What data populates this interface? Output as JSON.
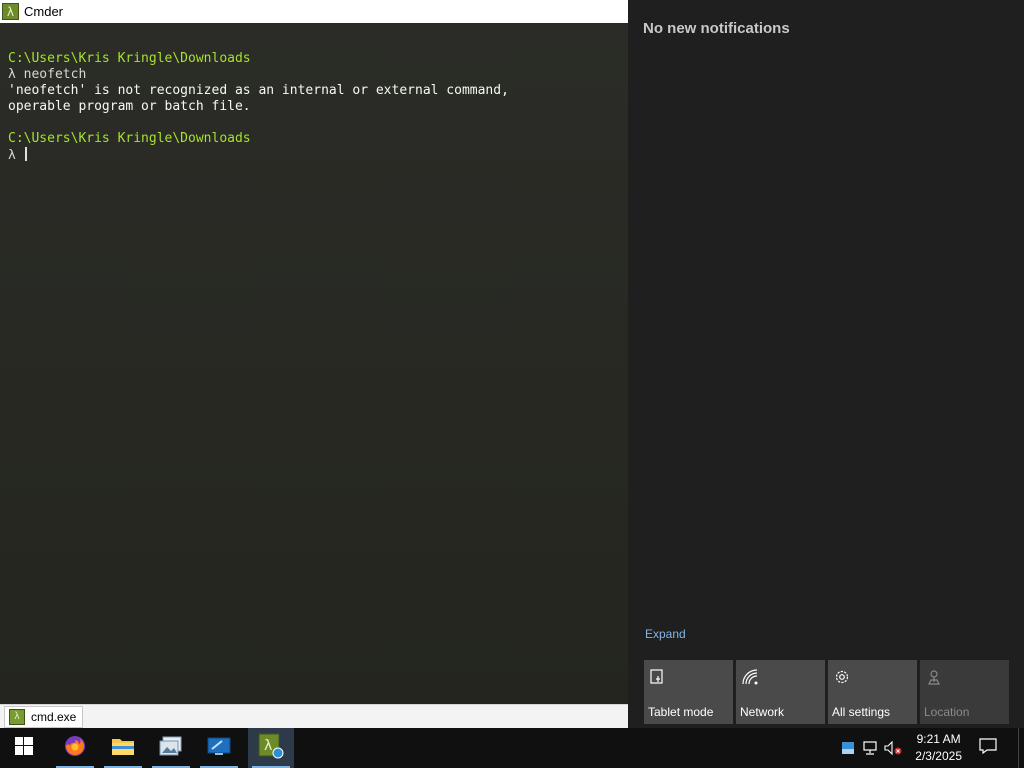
{
  "window": {
    "title": "Cmder",
    "icon": "lambda-icon"
  },
  "terminal": {
    "lines": [
      {
        "type": "path",
        "text": "C:\\Users\\Kris Kringle\\Downloads"
      },
      {
        "type": "prompt",
        "text": "λ neofetch"
      },
      {
        "type": "output",
        "text": "'neofetch' is not recognized as an internal or external command,"
      },
      {
        "type": "output",
        "text": "operable program or batch file."
      },
      {
        "type": "blank",
        "text": ""
      },
      {
        "type": "path",
        "text": "C:\\Users\\Kris Kringle\\Downloads"
      },
      {
        "type": "prompt",
        "text": "λ "
      }
    ]
  },
  "statusbar": {
    "tab_label": "cmd.exe"
  },
  "action_center": {
    "header": "No new notifications",
    "expand_label": "Expand",
    "quick_actions": [
      {
        "label": "Tablet mode",
        "icon": "tablet-mode-icon",
        "enabled": true
      },
      {
        "label": "Network",
        "icon": "network-icon",
        "enabled": true
      },
      {
        "label": "All settings",
        "icon": "gear-icon",
        "enabled": true
      },
      {
        "label": "Location",
        "icon": "location-icon",
        "enabled": false
      }
    ]
  },
  "taskbar": {
    "apps": [
      {
        "name": "firefox",
        "icon": "firefox-icon"
      },
      {
        "name": "file-explorer",
        "icon": "folder-icon"
      },
      {
        "name": "app-3",
        "icon": "pictures-icon"
      },
      {
        "name": "app-4",
        "icon": "remote-desktop-icon"
      },
      {
        "name": "cmder",
        "icon": "cmder-icon"
      }
    ],
    "clock": {
      "time": "9:21 AM",
      "date": "2/3/2025"
    }
  },
  "colors": {
    "terminal_bg": "#272822",
    "path_green": "#a6e22e",
    "action_center_bg": "#1f1f1f",
    "tile_bg": "#4a4a4a",
    "link_blue": "#82b5e6",
    "taskbar_bg": "#101010"
  }
}
